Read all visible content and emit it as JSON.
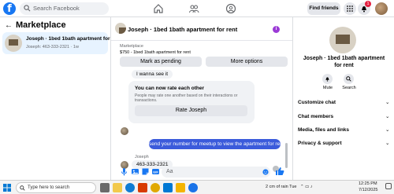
{
  "topbar": {
    "logo": "f",
    "search_placeholder": "Search Facebook",
    "find_friends": "Find friends",
    "notification_count": "1",
    "icons": [
      "home-icon",
      "friends-icon",
      "groups-icon",
      "menu-grid-icon",
      "messenger-icon",
      "bell-icon"
    ]
  },
  "sidebar": {
    "title": "Marketplace",
    "conversation": {
      "title": "Joseph · 1bed 1bath apartment for ...",
      "subtitle": "Joseph: 463-333-2321 · 1w"
    }
  },
  "chat": {
    "header_title": "Joseph · 1bed 1bath apartment for rent",
    "marketplace_label": "Marketplace",
    "listing": "$750 - 1bed 1bath apartment for rent",
    "mark_pending": "Mark as pending",
    "more_options": "More options",
    "messages": {
      "i_wanna_see": "I wanna see it",
      "rate_title": "You can now rate each other",
      "rate_desc": "People may rate one another based on their interactions or transactions.",
      "rate_button": "Rate Joseph",
      "outgoing": "send your number for meetup to view the apartment for rent",
      "sender": "Joseph",
      "incoming_number": "463-333-2321"
    },
    "composer_placeholder": "Aa"
  },
  "details": {
    "title": "Joseph · 1bed 1bath apartment for rent",
    "mute": "Mute",
    "search": "Search",
    "sections": [
      "Customize chat",
      "Chat members",
      "Media, files and links",
      "Privacy & support"
    ]
  },
  "taskbar": {
    "search_placeholder": "Type here to search",
    "weather": "2 cm of rain Tue",
    "time": "12:25 PM",
    "date": "7/12/2025"
  },
  "colors": {
    "facebook_blue": "#1877f2",
    "outgoing_bubble": "#3b5bdb",
    "badge_red": "#e41e3f"
  }
}
